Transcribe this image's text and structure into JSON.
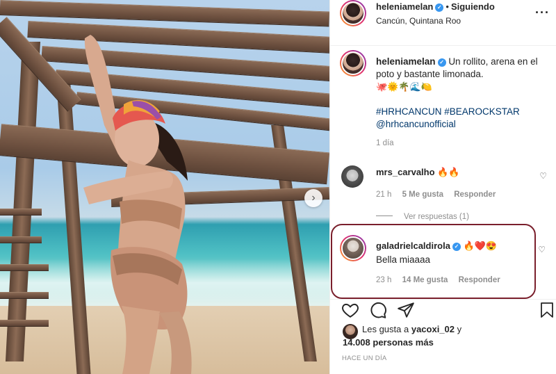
{
  "post": {
    "author": "heleniamelan",
    "follow_status": "Siguiendo",
    "location": "Cancún, Quintana Roo",
    "caption_line1": "Un rollito, arena en el",
    "caption_line2": "poto y bastante limonada.",
    "caption_emojis": "🐙🌞🌴🌊🍋",
    "hashtags": "#HRHCANCUN #BEAROCKSTAR",
    "mention": "@hrhcancunofficial",
    "caption_age": "1 día"
  },
  "comments": [
    {
      "user": "mrs_carvalho",
      "text": "🔥🔥",
      "age": "21 h",
      "likes": "5 Me gusta",
      "reply": "Responder",
      "view_replies": "Ver respuestas (1)"
    },
    {
      "user": "galadrielcaldirola",
      "emojis": "🔥❤️😍",
      "text": "Bella miaaaa",
      "age": "23 h",
      "likes": "14 Me gusta",
      "reply": "Responder"
    }
  ],
  "icons": {
    "more": "more-options-icon",
    "like": "heart-icon",
    "comment": "comment-icon",
    "share": "share-icon",
    "save": "bookmark-icon",
    "next": "chevron-right-icon",
    "verified": "verified-badge-icon"
  },
  "likes": {
    "prefix": "Les gusta a",
    "first_user": "yacoxi_02",
    "joiner": "y",
    "count_text": "14.008 personas más"
  },
  "timestamp": "HACE UN DÍA",
  "colors": {
    "highlight_border": "#7a1f2c",
    "verified": "#3897f0",
    "hashtag": "#00376b",
    "muted": "#8e8e8e"
  }
}
